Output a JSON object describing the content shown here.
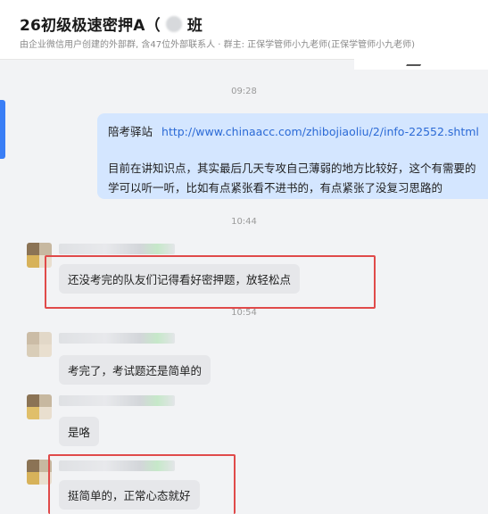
{
  "header": {
    "title": "26初级极速密押A（",
    "title_suffix": "班",
    "subtitle": "由企业微信用户创建的外部群, 含47位外部联系人 · 群主: 正保学管师小九老师(正保学管师小九老师)"
  },
  "messages": {
    "time_1": "09:28",
    "outgoing": {
      "prefix": "陪考驿站",
      "link": "http://www.chinaacc.com/zhibojiaoliu/2/info-22552.shtml",
      "line2": "目前在讲知识点，其实最后几天专攻自己薄弱的地方比较好，这个有需要的",
      "line3": "学可以听一听，比如有点紧张看不进书的，有点紧张了没复习思路的"
    },
    "time_2": "10:44",
    "msg_1": "还没考完的队友们记得看好密押题，放轻松点",
    "time_3": "10:54",
    "msg_2": "考完了，考试题还是简单的",
    "msg_3": "是咯",
    "msg_4": "挺简单的，正常心态就好"
  },
  "colors": {
    "accent": "#3a7ef6",
    "outgoing_bubble": "#d4e6ff",
    "incoming_bubble": "#e6e7ea",
    "highlight": "#e04a4a",
    "link": "#2b6ad6"
  }
}
